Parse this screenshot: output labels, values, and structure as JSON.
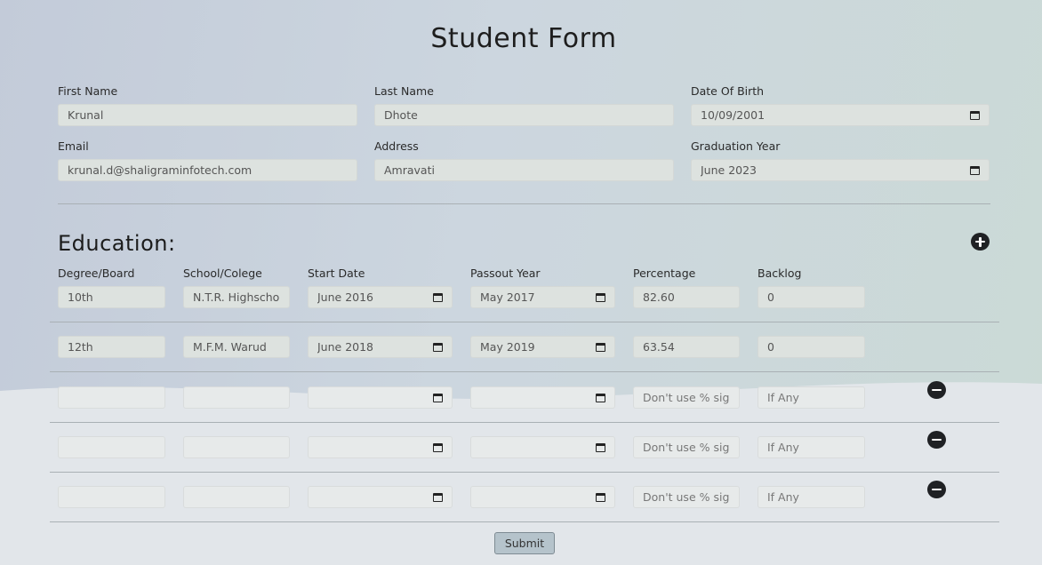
{
  "form": {
    "title": "Student Form",
    "first_name": {
      "label": "First Name",
      "value": "Krunal"
    },
    "last_name": {
      "label": "Last Name",
      "value": "Dhote"
    },
    "dob": {
      "label": "Date Of Birth",
      "value": "10/09/2001"
    },
    "email": {
      "label": "Email",
      "value": "krunal.d@shaligraminfotech.com"
    },
    "address": {
      "label": "Address",
      "value": "Amravati"
    },
    "graduation_year": {
      "label": "Graduation Year",
      "value": "June 2023"
    }
  },
  "education": {
    "title": "Education:",
    "add_icon": "plus-circle-icon",
    "remove_icon": "minus-circle-icon",
    "columns": [
      "Degree/Board",
      "School/Colege",
      "Start Date",
      "Passout Year",
      "Percentage",
      "Backlog"
    ],
    "percentage_placeholder": "Don't use % sign",
    "backlog_placeholder": "If Any",
    "rows": [
      {
        "degree": "10th",
        "school": "N.T.R. Highschool",
        "start": "June 2016",
        "passout": "May 2017",
        "percentage": "82.60",
        "backlog": "0"
      },
      {
        "degree": "12th",
        "school": "M.F.M. Warud",
        "start": "June 2018",
        "passout": "May 2019",
        "percentage": "63.54",
        "backlog": "0"
      },
      {
        "degree": "",
        "school": "",
        "start": "",
        "passout": "",
        "percentage": "",
        "backlog": ""
      },
      {
        "degree": "",
        "school": "",
        "start": "",
        "passout": "",
        "percentage": "",
        "backlog": ""
      },
      {
        "degree": "",
        "school": "",
        "start": "",
        "passout": "",
        "percentage": "",
        "backlog": ""
      }
    ]
  },
  "submit_label": "Submit"
}
